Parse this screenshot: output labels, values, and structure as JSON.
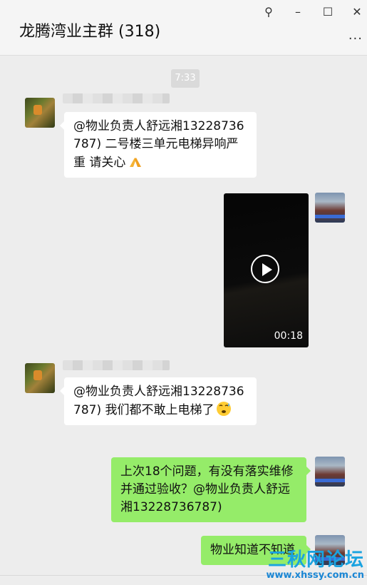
{
  "window": {
    "title": "龙腾湾业主群 (318)",
    "buttons": {
      "pin": "⚲",
      "minimize": "–",
      "maximize": "☐",
      "close": "✕"
    },
    "more_label": "···"
  },
  "chat": {
    "timestamp": "7:33",
    "messages": [
      {
        "side": "left",
        "text": "@物业负责人舒远湘13228736787) 二号楼三单元电梯异响严重 请关心",
        "emoji": "folded-hands"
      },
      {
        "side": "right",
        "type": "video",
        "duration": "00:18"
      },
      {
        "side": "left",
        "text": "@物业负责人舒远湘13228736787) 我们都不敢上电梯了",
        "emoji": "sweat-face"
      },
      {
        "side": "right",
        "text": "上次18个问题，有没有落实维修并通过验收？@物业负责人舒远湘13228736787)"
      },
      {
        "side": "right",
        "text": "物业知道不知道"
      }
    ]
  },
  "watermark": {
    "title": "三秋网论坛",
    "url": "www.xhssy.com.cn"
  },
  "colors": {
    "self_bubble": "#95ec69",
    "other_bubble": "#ffffff",
    "background": "#ededed"
  }
}
